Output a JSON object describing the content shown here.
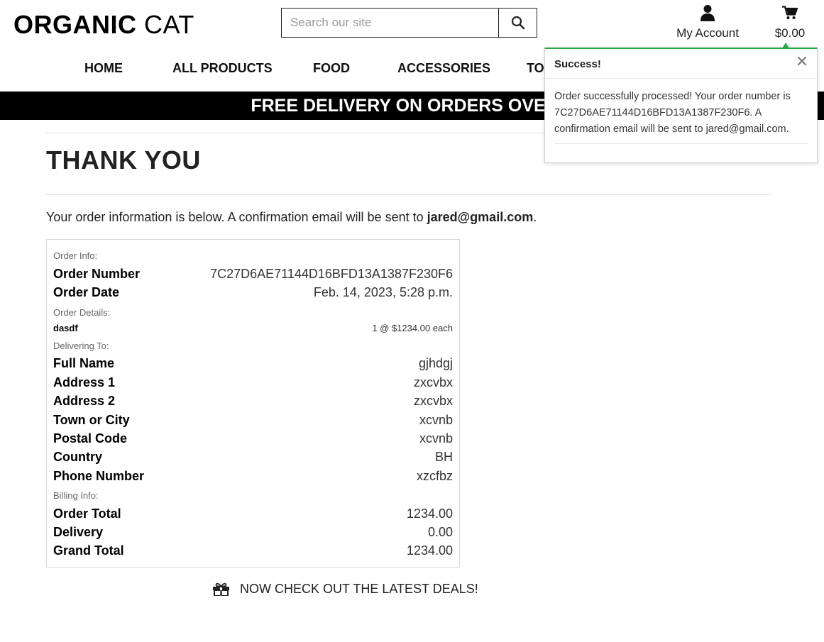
{
  "header": {
    "logo_bold": "ORGANIC",
    "logo_light": "CAT",
    "search_placeholder": "Search our site",
    "account_label": "My Account",
    "cart_total": "$0.00"
  },
  "nav": {
    "items": [
      "HOME",
      "ALL PRODUCTS",
      "FOOD",
      "ACCESSORIES",
      "TOYS"
    ]
  },
  "banner": {
    "text": "FREE DELIVERY ON ORDERS OVER $"
  },
  "toast": {
    "title": "Success!",
    "message": "Order successfully processed! Your order number is 7C27D6AE71144D16BFD13A1387F230F6. A confirmation email will be sent to jared@gmail.com.",
    "accent": "#28a745"
  },
  "page": {
    "title": "THANK YOU",
    "intro_text": "Your order information is below. A confirmation email will be sent to ",
    "email": "jared@gmail.com",
    "intro_end": "."
  },
  "order": {
    "info_heading": "Order Info:",
    "number_label": "Order Number",
    "number": "7C27D6AE71144D16BFD13A1387F230F6",
    "date_label": "Order Date",
    "date": "Feb. 14, 2023, 5:28 p.m.",
    "details_heading": "Order Details:",
    "item_name": "dasdf",
    "item_qty": "1 @ $1234.00 each",
    "delivering_heading": "Delivering To:",
    "full_name_label": "Full Name",
    "full_name": "gjhdgj",
    "address1_label": "Address 1",
    "address1": "zxcvbx",
    "address2_label": "Address 2",
    "address2": "zxcvbx",
    "town_label": "Town or City",
    "town": "xcvnb",
    "postal_label": "Postal Code",
    "postal": "xcvnb",
    "country_label": "Country",
    "country": "BH",
    "phone_label": "Phone Number",
    "phone": "xzcfbz",
    "billing_heading": "Billing Info:",
    "order_total_label": "Order Total",
    "order_total": "1234.00",
    "delivery_label": "Delivery",
    "delivery": "0.00",
    "grand_total_label": "Grand Total",
    "grand_total": "1234.00"
  },
  "deals": {
    "label": "NOW CHECK OUT THE LATEST DEALS!"
  },
  "icons": {
    "search": "search-icon",
    "account": "user-icon",
    "cart": "cart-icon",
    "close": "close-icon",
    "deals": "gift-icon"
  }
}
